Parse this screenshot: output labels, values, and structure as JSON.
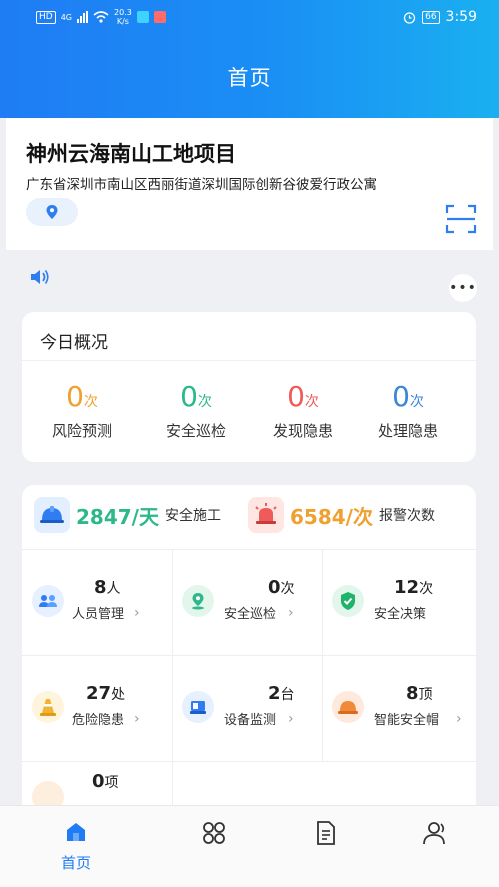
{
  "status_bar": {
    "hd": "HD",
    "network": "4G",
    "speed_value": "20.3",
    "speed_unit": "K/s",
    "battery": "66",
    "time": "3:59"
  },
  "header": {
    "title": "首页"
  },
  "project": {
    "name": "神州云海南山工地项目",
    "address": "广东省深圳市南山区西丽街道深圳国际创新谷彼爱行政公寓"
  },
  "today": {
    "title": "今日概况",
    "stats": [
      {
        "value": "0",
        "unit": "次",
        "label": "风险预测",
        "color": "#f0a030"
      },
      {
        "value": "0",
        "unit": "次",
        "label": "安全巡检",
        "color": "#2cb88a"
      },
      {
        "value": "0",
        "unit": "次",
        "label": "发现隐患",
        "color": "#f05a5a"
      },
      {
        "value": "0",
        "unit": "次",
        "label": "处理隐患",
        "color": "#3a86d8"
      }
    ]
  },
  "summary": [
    {
      "value": "2847/天",
      "label": "安全施工",
      "color": "#2cb88a",
      "icon": "helmet-icon"
    },
    {
      "value": "6584/次",
      "label": "报警次数",
      "color": "#f0a030",
      "icon": "alarm-icon"
    }
  ],
  "modules": [
    {
      "value": "8",
      "unit": "人",
      "label": "人员管理",
      "icon": "people-icon",
      "icon_bg": "#e6f0ff",
      "icon_color": "#2f7df0"
    },
    {
      "value": "0",
      "unit": "次",
      "label": "安全巡检",
      "icon": "location-icon",
      "icon_bg": "#e2f6ec",
      "icon_color": "#2cb88a"
    },
    {
      "value": "12",
      "unit": "次",
      "label": "安全决策",
      "icon": "shield-icon",
      "icon_bg": "#e2f6ec",
      "icon_color": "#1fb36b"
    },
    {
      "value": "27",
      "unit": "处",
      "label": "危险隐患",
      "icon": "cone-icon",
      "icon_bg": "#fff4dc",
      "icon_color": "#f2b233"
    },
    {
      "value": "2",
      "unit": "台",
      "label": "设备监测",
      "icon": "equipment-icon",
      "icon_bg": "#e6f0ff",
      "icon_color": "#2f7df0"
    },
    {
      "value": "8",
      "unit": "顶",
      "label": "智能安全帽",
      "icon": "hardhat-icon",
      "icon_bg": "#ffe9dc",
      "icon_color": "#f08a3a"
    },
    {
      "value": "0",
      "unit": "项",
      "label": "",
      "icon": "partial-icon",
      "icon_bg": "#fdeedd",
      "icon_color": "#f08a3a"
    }
  ],
  "nav": [
    {
      "label": "首页",
      "icon": "home-icon",
      "active": true
    },
    {
      "label": "",
      "icon": "apps-icon",
      "active": false
    },
    {
      "label": "",
      "icon": "document-icon",
      "active": false
    },
    {
      "label": "",
      "icon": "user-icon",
      "active": false
    }
  ],
  "colors": {
    "brand": "#1f7cf4",
    "accent_green": "#2cb88a",
    "accent_orange": "#f0a030",
    "accent_red": "#f05a5a"
  }
}
